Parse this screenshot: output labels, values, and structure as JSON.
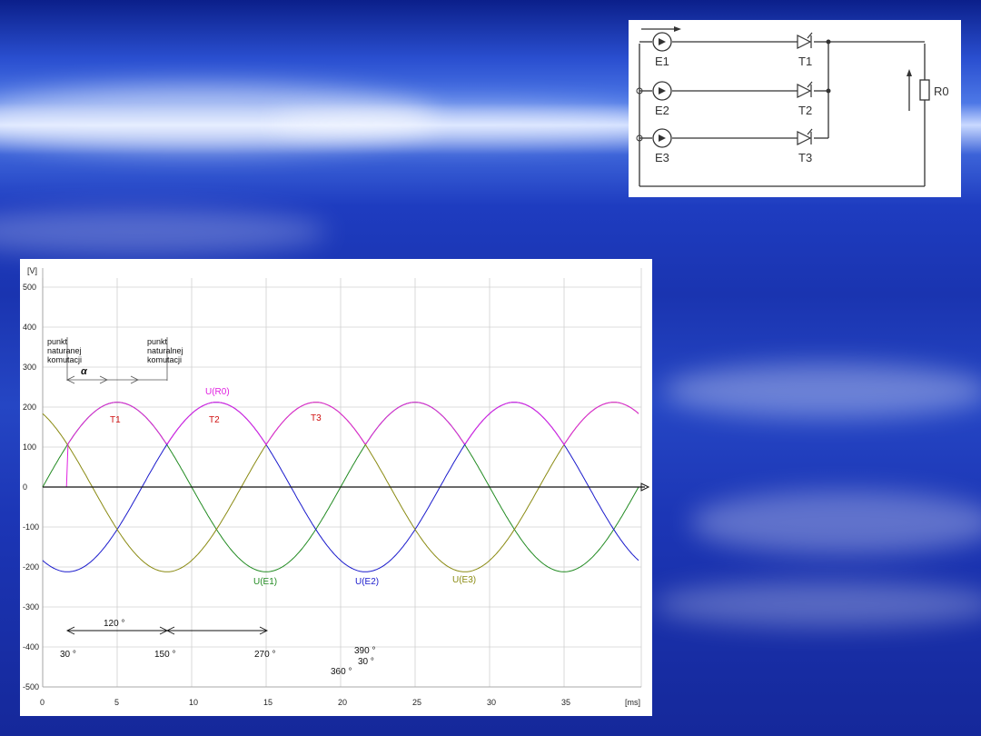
{
  "circuit": {
    "sources": [
      "E1",
      "E2",
      "E3"
    ],
    "thyristors": [
      "T1",
      "T2",
      "T3"
    ],
    "resistor": "R0"
  },
  "chart": {
    "y_unit": "[V]",
    "x_unit": "[ms]",
    "y_ticks": [
      "500",
      "400",
      "300",
      "200",
      "100",
      "0",
      "-100",
      "-200",
      "-300",
      "-400",
      "-500"
    ],
    "x_ticks": [
      "0",
      "5",
      "10",
      "15",
      "20",
      "25",
      "30",
      "35"
    ],
    "annotations": {
      "punkt1": [
        "punkt",
        "naturanej",
        "komutacji"
      ],
      "punkt2": [
        "punkt",
        "naturalnej",
        "komutacji"
      ],
      "alpha": "α",
      "t1": "T1",
      "t2": "T2",
      "t3": "T3",
      "ur0": "U(R0)",
      "ue1": "U(E1)",
      "ue2": "U(E2)",
      "ue3": "U(E3)",
      "deg120": "120 °",
      "deg30": "30 °",
      "deg150": "150 °",
      "deg270": "270 °",
      "deg390": "390 °",
      "deg30b": "30 °",
      "deg360": "360 °"
    }
  },
  "chart_data": {
    "type": "line",
    "xlabel": "[ms]",
    "ylabel": "[V]",
    "xlim": [
      0,
      40
    ],
    "ylim": [
      -500,
      500
    ],
    "amplitude": 212,
    "period_ms": 20,
    "firing_time_ms": 1.67,
    "series": [
      {
        "name": "U(E1)",
        "color": "#228b22",
        "phase_deg": 0
      },
      {
        "name": "U(E2)",
        "color": "#1a1acc",
        "phase_deg": -120
      },
      {
        "name": "U(E3)",
        "color": "#8a8a12",
        "phase_deg": -240
      },
      {
        "name": "U(R0)",
        "color": "#e020e0"
      }
    ]
  }
}
